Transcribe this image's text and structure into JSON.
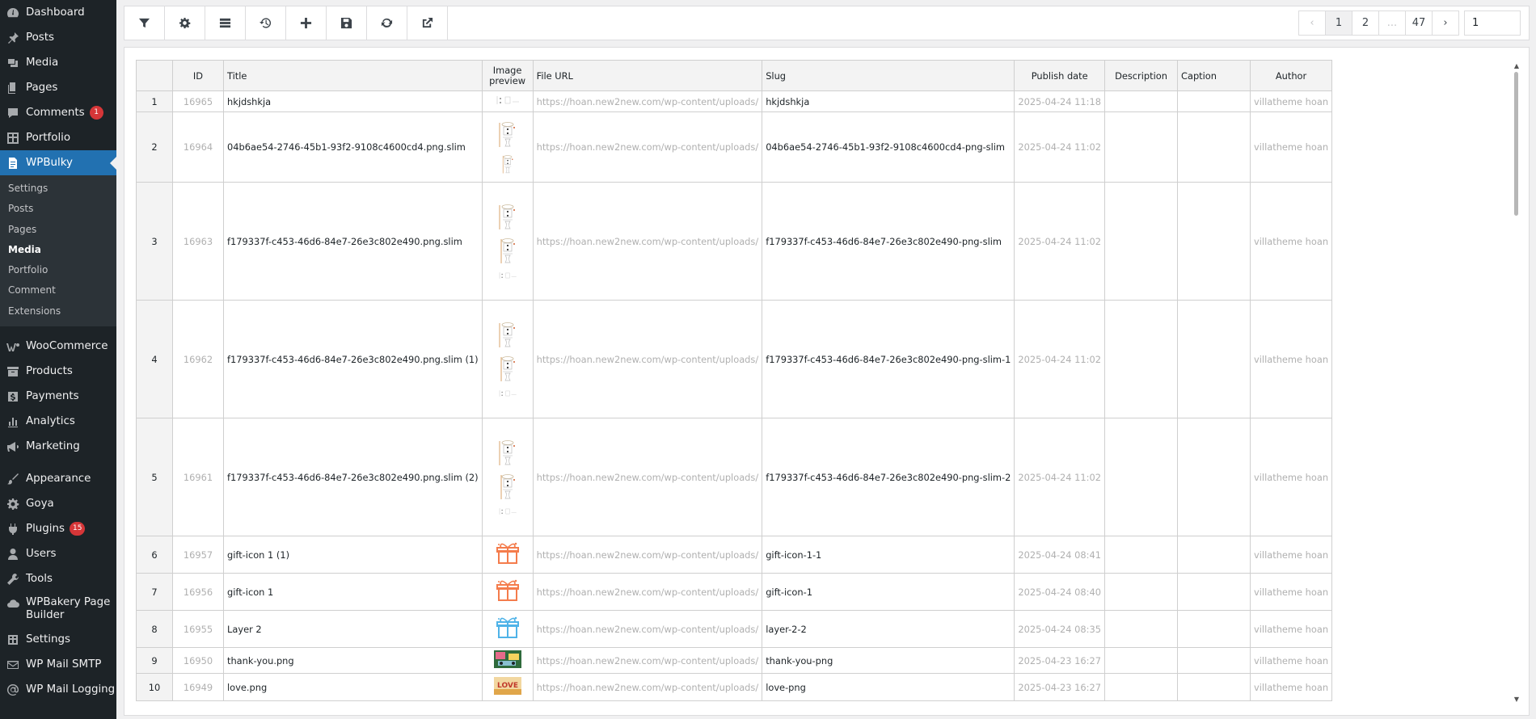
{
  "sidebar": {
    "top_items": [
      {
        "label": "Dashboard",
        "icon": "dashboard-icon"
      },
      {
        "label": "Posts",
        "icon": "pin-icon"
      },
      {
        "label": "Media",
        "icon": "media-icon"
      },
      {
        "label": "Pages",
        "icon": "pages-icon"
      },
      {
        "label": "Comments",
        "icon": "comment-icon",
        "badge": "1"
      },
      {
        "label": "Portfolio",
        "icon": "portfolio-icon"
      },
      {
        "label": "WPBulky",
        "icon": "document-icon",
        "active": true
      }
    ],
    "submenu": [
      {
        "label": "Settings"
      },
      {
        "label": "Posts"
      },
      {
        "label": "Pages"
      },
      {
        "label": "Media",
        "current": true
      },
      {
        "label": "Portfolio"
      },
      {
        "label": "Comment"
      },
      {
        "label": "Extensions"
      }
    ],
    "woo_items": [
      {
        "label": "WooCommerce",
        "icon": "woo-icon"
      },
      {
        "label": "Products",
        "icon": "archive-icon"
      },
      {
        "label": "Payments",
        "icon": "dollar-icon"
      },
      {
        "label": "Analytics",
        "icon": "bar-chart-icon"
      },
      {
        "label": "Marketing",
        "icon": "megaphone-icon"
      }
    ],
    "lower_items": [
      {
        "label": "Appearance",
        "icon": "brush-icon"
      },
      {
        "label": "Goya",
        "icon": "gear-icon"
      },
      {
        "label": "Plugins",
        "icon": "plugin-icon",
        "badge": "15"
      },
      {
        "label": "Users",
        "icon": "user-icon"
      },
      {
        "label": "Tools",
        "icon": "wrench-icon"
      },
      {
        "label": "WPBakery Page Builder",
        "icon": "cloud-icon",
        "two_line": true
      },
      {
        "label": "Settings",
        "icon": "settings-icon"
      },
      {
        "label": "WP Mail SMTP",
        "icon": "mail-icon"
      },
      {
        "label": "WP Mail Logging",
        "icon": "at-icon"
      }
    ]
  },
  "toolbar": {
    "buttons": [
      {
        "name": "filter-button",
        "icon": "filter-icon"
      },
      {
        "name": "settings-button",
        "icon": "gear-icon"
      },
      {
        "name": "columns-button",
        "icon": "stack-icon"
      },
      {
        "name": "history-button",
        "icon": "history-icon"
      },
      {
        "name": "add-button",
        "icon": "plus-icon"
      },
      {
        "name": "save-button",
        "icon": "save-icon"
      },
      {
        "name": "reload-button",
        "icon": "refresh-icon"
      },
      {
        "name": "open-external-button",
        "icon": "external-link-icon"
      }
    ]
  },
  "pagination": {
    "prev": "‹",
    "pages": [
      "1",
      "2",
      "...",
      "47"
    ],
    "current": "1",
    "next": "›",
    "goto_value": "1"
  },
  "grid": {
    "columns": [
      "",
      "ID",
      "Title",
      "Image preview",
      "File URL",
      "Slug",
      "Publish date",
      "Description",
      "Caption",
      "Author"
    ],
    "rows": [
      {
        "num": "1",
        "id": "16965",
        "title": "hkjdshkja",
        "preview": "sketch-small",
        "url": "https://hoan.new2new.com/wp-content/uploads/",
        "slug": "hkjdshkja",
        "date": "2025-04-24 11:18",
        "description": "",
        "caption": "",
        "author": "villatheme hoan"
      },
      {
        "num": "2",
        "id": "16964",
        "title": "04b6ae54-2746-45b1-93f2-9108c4600cd4.png.slim",
        "preview": "sketch-1",
        "url": "https://hoan.new2new.com/wp-content/uploads/",
        "slug": "04b6ae54-2746-45b1-93f2-9108c4600cd4-png-slim",
        "date": "2025-04-24 11:02",
        "description": "",
        "caption": "",
        "author": "villatheme hoan"
      },
      {
        "num": "3",
        "id": "16963",
        "title": "f179337f-c453-46d6-84e7-26e3c802e490.png.slim",
        "preview": "sketch-3",
        "url": "https://hoan.new2new.com/wp-content/uploads/",
        "slug": "f179337f-c453-46d6-84e7-26e3c802e490-png-slim",
        "date": "2025-04-24 11:02",
        "description": "",
        "caption": "",
        "author": "villatheme hoan"
      },
      {
        "num": "4",
        "id": "16962",
        "title": "f179337f-c453-46d6-84e7-26e3c802e490.png.slim (1)",
        "preview": "sketch-3",
        "url": "https://hoan.new2new.com/wp-content/uploads/",
        "slug": "f179337f-c453-46d6-84e7-26e3c802e490-png-slim-1",
        "date": "2025-04-24 11:02",
        "description": "",
        "caption": "",
        "author": "villatheme hoan"
      },
      {
        "num": "5",
        "id": "16961",
        "title": "f179337f-c453-46d6-84e7-26e3c802e490.png.slim (2)",
        "preview": "sketch-3",
        "url": "https://hoan.new2new.com/wp-content/uploads/",
        "slug": "f179337f-c453-46d6-84e7-26e3c802e490-png-slim-2",
        "date": "2025-04-24 11:02",
        "description": "",
        "caption": "",
        "author": "villatheme hoan"
      },
      {
        "num": "6",
        "id": "16957",
        "title": "gift-icon 1 (1)",
        "preview": "gift-orange",
        "url": "https://hoan.new2new.com/wp-content/uploads/",
        "slug": "gift-icon-1-1",
        "date": "2025-04-24 08:41",
        "description": "",
        "caption": "",
        "author": "villatheme hoan"
      },
      {
        "num": "7",
        "id": "16956",
        "title": "gift-icon 1",
        "preview": "gift-orange",
        "url": "https://hoan.new2new.com/wp-content/uploads/",
        "slug": "gift-icon-1",
        "date": "2025-04-24 08:40",
        "description": "",
        "caption": "",
        "author": "villatheme hoan"
      },
      {
        "num": "8",
        "id": "16955",
        "title": "Layer 2",
        "preview": "gift-blue",
        "url": "https://hoan.new2new.com/wp-content/uploads/",
        "slug": "layer-2-2",
        "date": "2025-04-24 08:35",
        "description": "",
        "caption": "",
        "author": "villatheme hoan"
      },
      {
        "num": "9",
        "id": "16950",
        "title": "thank-you.png",
        "preview": "photo-thankyou",
        "url": "https://hoan.new2new.com/wp-content/uploads/",
        "slug": "thank-you-png",
        "date": "2025-04-23 16:27",
        "description": "",
        "caption": "",
        "author": "villatheme hoan"
      },
      {
        "num": "10",
        "id": "16949",
        "title": "love.png",
        "preview": "photo-love",
        "url": "https://hoan.new2new.com/wp-content/uploads/",
        "slug": "love-png",
        "date": "2025-04-23 16:27",
        "description": "",
        "caption": "",
        "author": "villatheme hoan"
      }
    ]
  },
  "colors": {
    "sidebar_bg": "#1d2327",
    "active_bg": "#2271b1",
    "badge": "#d63638",
    "gift_orange": "#f47c4c",
    "gift_blue": "#4fb3e8"
  }
}
